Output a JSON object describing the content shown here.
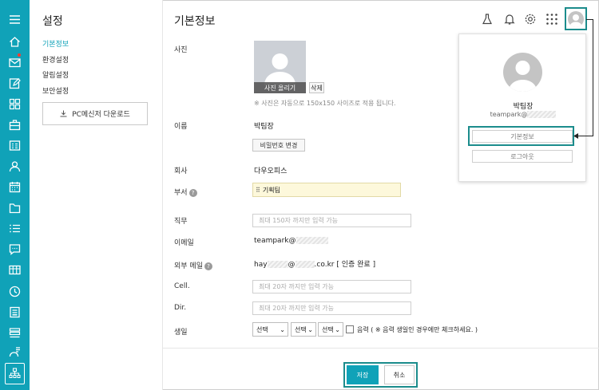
{
  "sidebar": {
    "title": "설정",
    "items": [
      {
        "label": "기본정보",
        "active": true
      },
      {
        "label": "환경설정",
        "active": false
      },
      {
        "label": "알림설정",
        "active": false
      },
      {
        "label": "보안설정",
        "active": false
      }
    ],
    "download_label": "PC메신저 다운로드"
  },
  "header": {
    "title": "기본정보",
    "icons": [
      "flask-icon",
      "bell-icon",
      "gear-icon",
      "apps-grid-icon",
      "avatar-icon"
    ]
  },
  "form": {
    "photo": {
      "label": "사진",
      "upload_label": "사진 올리기",
      "delete_label": "삭제",
      "hint": "※ 사진은 자동으로 150x150 사이즈로 적용 됩니다."
    },
    "name": {
      "label": "이름",
      "value": "박팀장",
      "password_button": "비밀번호 변경"
    },
    "company": {
      "label": "회사",
      "value": "다우오피스"
    },
    "department": {
      "label": "부서",
      "value": "기획팀"
    },
    "position": {
      "label": "직무",
      "placeholder": "최대 150자 까지만 입력 가능"
    },
    "email": {
      "label": "이메일",
      "value": "teampark@"
    },
    "external_email": {
      "label": "외부 메일",
      "prefix": "hay",
      "at": "@",
      "domain_suffix": ".co.kr",
      "status": "[ 인증 완료 ]"
    },
    "cell": {
      "label": "Cell.",
      "placeholder": "최대 20자 까지만 입력 가능"
    },
    "dir": {
      "label": "Dir.",
      "placeholder": "최대 20자 까지만 입력 가능"
    },
    "birthday": {
      "label": "생일",
      "selects": [
        "선택",
        "선택",
        "선택"
      ],
      "lunar_label": "음력 ( ※ 음력 생일인 경우에만 체크하세요. )"
    }
  },
  "actions": {
    "save_label": "저장",
    "cancel_label": "취소"
  },
  "profile_popup": {
    "name": "박팀장",
    "email": "teampark@",
    "info_button": "기본정보",
    "logout_button": "로그아웃"
  },
  "colors": {
    "accent": "#10a2b8",
    "highlight_border": "#1b8c8c",
    "notification_dot": "#ff3b30"
  }
}
